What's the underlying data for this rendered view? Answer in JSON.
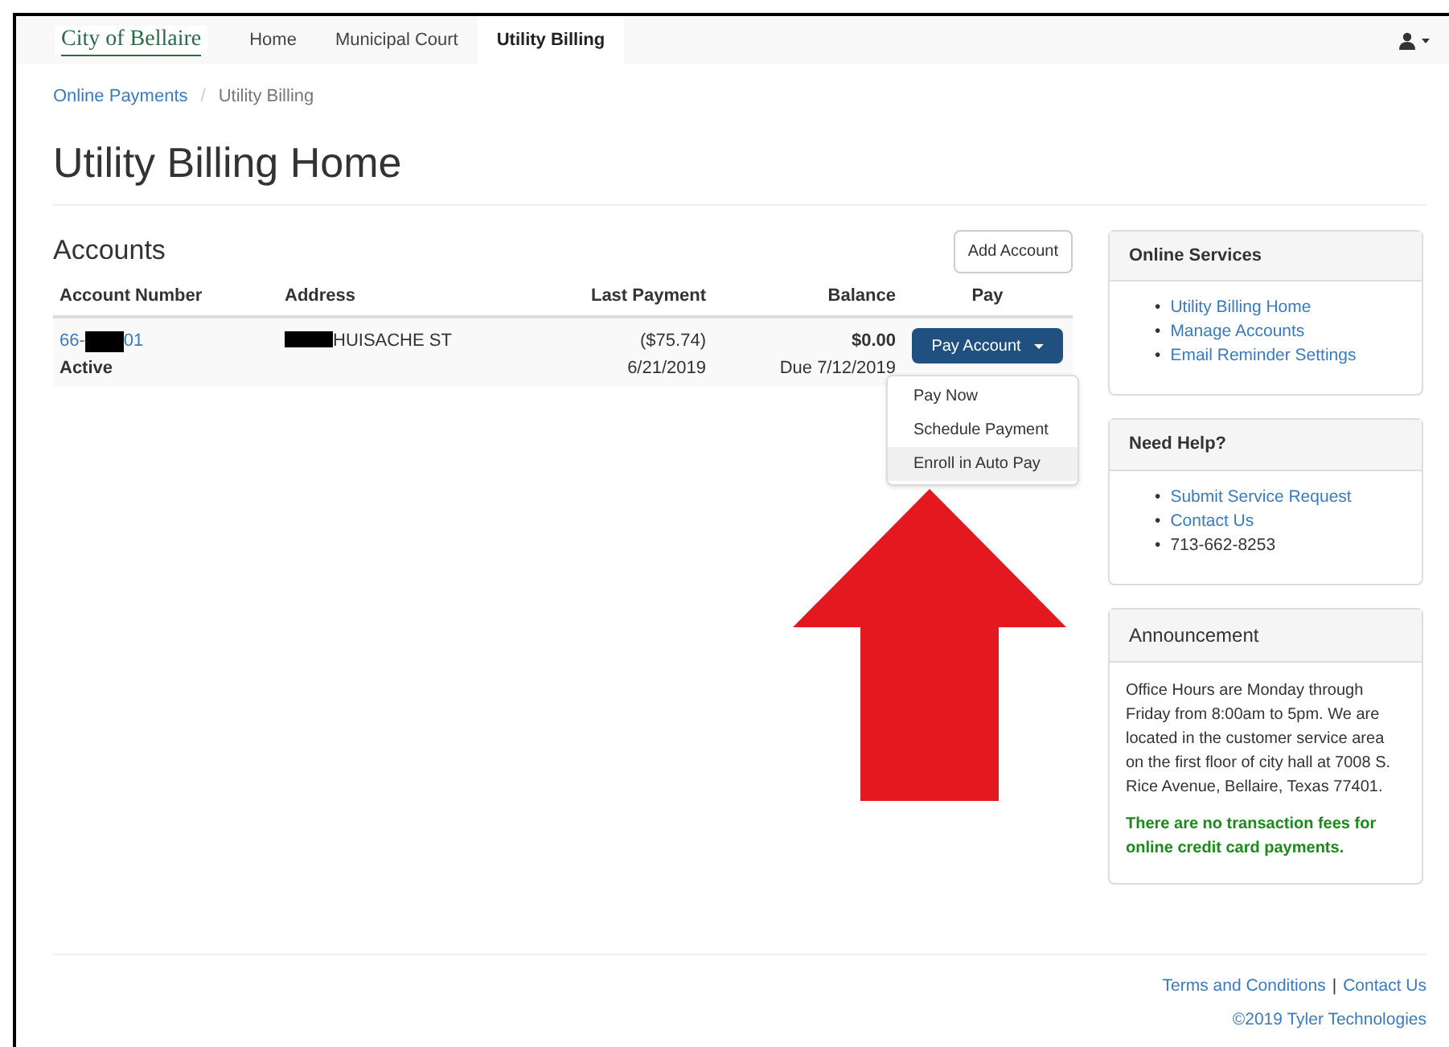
{
  "navbar": {
    "logo": "City of Bellaire",
    "tabs": [
      {
        "label": "Home",
        "selected": false
      },
      {
        "label": "Municipal Court",
        "selected": false
      },
      {
        "label": "Utility Billing",
        "selected": true
      }
    ]
  },
  "breadcrumb": [
    {
      "label": "Online Payments",
      "kind": "link"
    },
    {
      "label": "/",
      "kind": "separator"
    },
    {
      "label": "Utility Billing",
      "kind": "current"
    }
  ],
  "page_title": "Utility Billing Home",
  "accounts": {
    "title": "Accounts",
    "add_button": "Add Account",
    "columns": [
      "Account Number",
      "Address",
      "Last Payment",
      "Balance",
      "Pay"
    ],
    "rows": [
      {
        "account_prefix": "66-",
        "account_suffix": "01",
        "status": "Active",
        "address": "HUISACHE ST",
        "last_payment": "($75.74)",
        "last_payment_date": "6/21/2019",
        "balance": "$0.00",
        "due": "Due 7/12/2019",
        "pay_button": "Pay Account",
        "expanded": true,
        "menu": [
          {
            "label": "Pay Now",
            "selected": false
          },
          {
            "label": "Schedule Payment",
            "selected": false
          },
          {
            "label": "Enroll in Auto Pay",
            "selected": true
          }
        ]
      }
    ]
  },
  "panels": [
    {
      "title": "Online Services",
      "kind": "list",
      "bullet": "•",
      "items": [
        {
          "label": "Utility Billing Home",
          "kind": "link"
        },
        {
          "label": "Manage Accounts",
          "kind": "link"
        },
        {
          "label": "Email Reminder Settings",
          "kind": "link"
        }
      ]
    },
    {
      "title": "Need Help?",
      "kind": "list",
      "bullet": "•",
      "items": [
        {
          "label": "Submit Service Request",
          "kind": "link"
        },
        {
          "label": "Contact Us",
          "kind": "link"
        },
        {
          "label": "713-662-8253",
          "kind": "text"
        }
      ]
    },
    {
      "title": "Announcement",
      "kind": "text",
      "body": "Office Hours are Monday through Friday from 8:00am to 5pm. We are located in the customer service area on the first floor of city hall at 7008 S. Rice Avenue, Bellaire, Texas 77401.",
      "note": "There are no transaction fees for online credit card payments."
    }
  ],
  "footer": {
    "links": [
      "Terms and Conditions",
      "Contact Us"
    ],
    "separator": "|",
    "copyright": "©2019 Tyler Technologies"
  }
}
